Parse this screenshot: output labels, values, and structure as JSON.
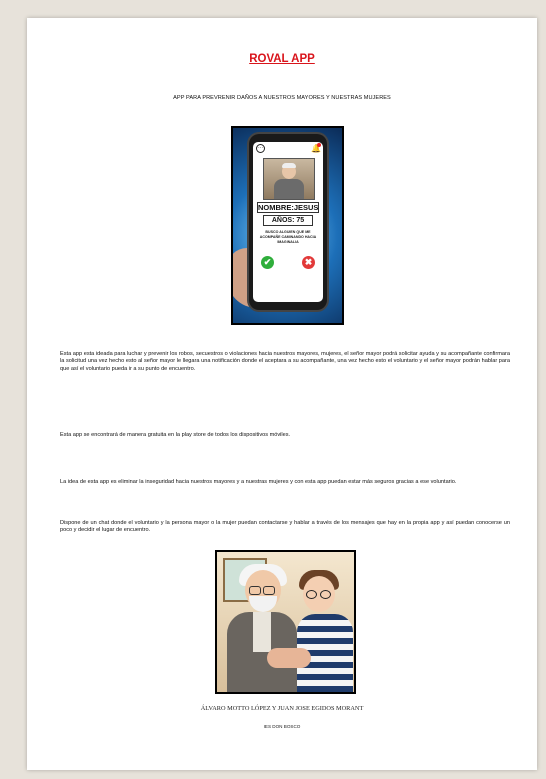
{
  "document": {
    "title": "ROVAL APP",
    "subtitle": "APP PARA PREVRENIR DAÑOS A NUESTROS MAYORES Y NUESTRAS MUJERES",
    "phone_mockup": {
      "name_label": "NOMBRE:JESUS",
      "age_label": "AÑOS: 75",
      "request_text": "BUSCO ALGUIEN QUE ME ACOMPAÑE CAMINANDO HACIA IMAGINALIA",
      "accept_symbol": "✔",
      "reject_symbol": "✖"
    },
    "paragraphs": [
      "Esta app esta ideada para luchar y prevenir los robos, secuestros o violaciones hacia nuestros mayores, mujeres, el señor mayor podrá solicitar ayuda y su acompañante confirmara la solicitud una vez hecho esto al señor mayor le llegara una notificación donde el aceptara a su acompañante, una vez hecho esto el voluntario y el señor mayor podrán hablar para que así el voluntario pueda ir a su punto de encuentro.",
      "Esta app se encontrará de manera gratuita en la play store de todos los dispositivos móviles.",
      "La idea de esta app es eliminar la inseguridad hacia nuestros mayores y a nuestras mujeres y con esta app puedan estar más seguros gracias a ese voluntario.",
      "Dispone de un chat donde el voluntario y la persona mayor o la mujer puedan contactarse y hablar a través de los mensajes que hay en la propia app y así puedan conocerse un poco y decidir el lugar de encuentro."
    ],
    "authors": "ÁLVARO MOTTO LÓPEZ Y JUAN JOSE EGIDOS MORANT",
    "school": "IES DON BOSCO"
  },
  "colors": {
    "title": "#d9141b",
    "background": "#e7e2da",
    "page": "#ffffff"
  }
}
